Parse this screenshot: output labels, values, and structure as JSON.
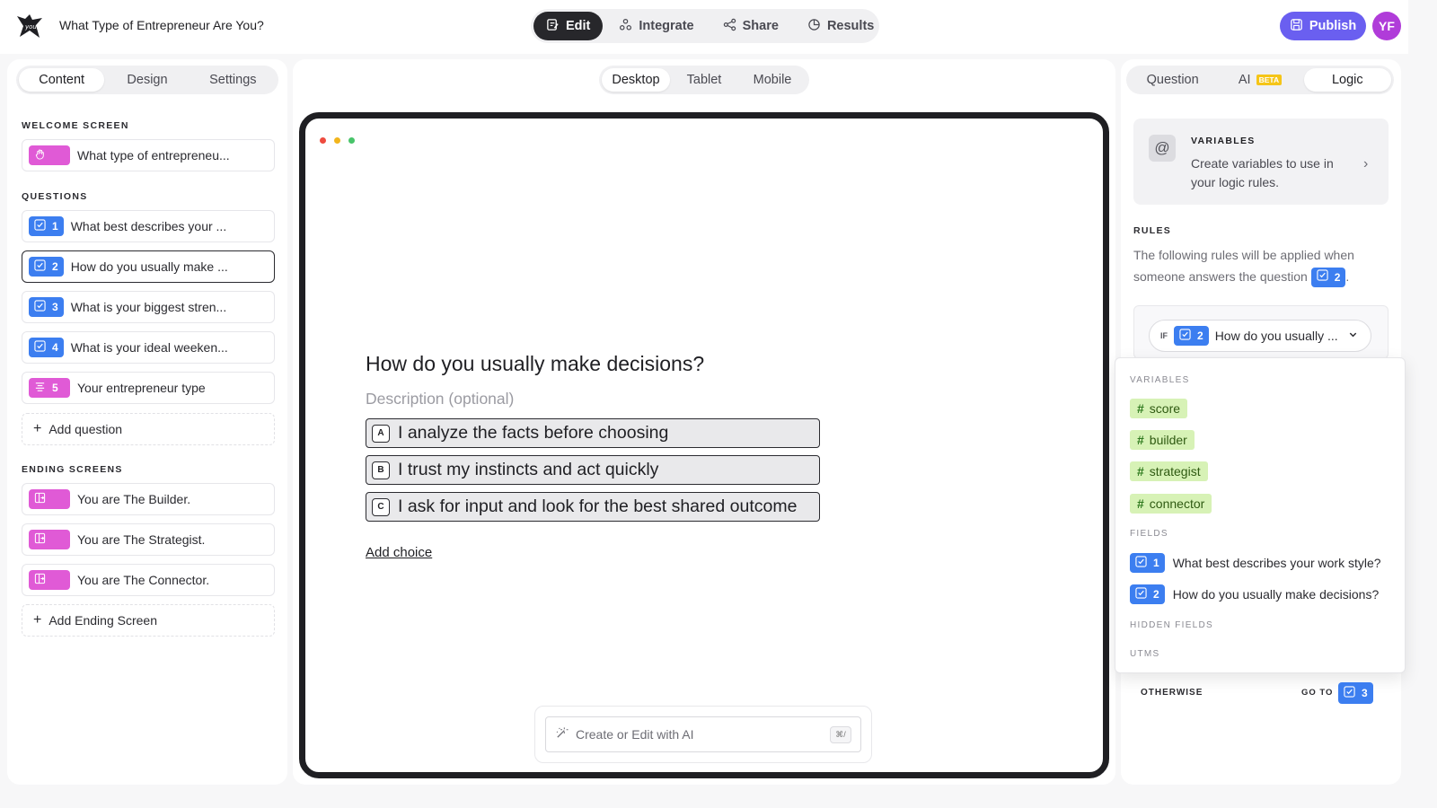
{
  "header": {
    "form_title": "What Type of Entrepreneur Are You?",
    "tabs": [
      {
        "label": "Edit",
        "icon": "edit-icon"
      },
      {
        "label": "Integrate",
        "icon": "integrate-icon"
      },
      {
        "label": "Share",
        "icon": "share-icon"
      },
      {
        "label": "Results",
        "icon": "results-icon"
      }
    ],
    "publish_label": "Publish",
    "avatar_initials": "YF"
  },
  "left": {
    "tabs": [
      "Content",
      "Design",
      "Settings"
    ],
    "welcome_label": "WELCOME SCREEN",
    "welcome_item": "What type of entrepreneu...",
    "questions_label": "QUESTIONS",
    "questions": [
      {
        "num": "1",
        "text": "What best describes your ..."
      },
      {
        "num": "2",
        "text": "How do you usually make ..."
      },
      {
        "num": "3",
        "text": "What is your biggest stren..."
      },
      {
        "num": "4",
        "text": "What is your ideal weeken..."
      },
      {
        "num": "5",
        "text": "Your entrepreneur type"
      }
    ],
    "add_question": "Add question",
    "ending_label": "ENDING SCREENS",
    "endings": [
      "You are The Builder.",
      "You are The Strategist.",
      "You are The Connector."
    ],
    "add_ending": "Add Ending Screen"
  },
  "center": {
    "device_tabs": [
      "Desktop",
      "Tablet",
      "Mobile"
    ],
    "question": "How do you usually make decisions?",
    "description_placeholder": "Description (optional)",
    "choices": [
      {
        "key": "A",
        "text": "I analyze the facts before choosing"
      },
      {
        "key": "B",
        "text": "I trust my instincts and act quickly"
      },
      {
        "key": "C",
        "text": "I ask for input and look for the best shared outcome"
      }
    ],
    "add_choice": "Add choice",
    "ai_placeholder": "Create or Edit with AI",
    "ai_shortcut": "⌘/"
  },
  "right": {
    "tabs": [
      "Question",
      "AI",
      "Logic"
    ],
    "ai_badge": "BETA",
    "variables_title": "VARIABLES",
    "variables_desc": "Create variables to use in your logic rules.",
    "rules_label": "RULES",
    "rules_text": "The following rules will be applied when someone answers the question",
    "rules_question_num": "2",
    "if_label": "IF",
    "if_num": "2",
    "if_text": "How do you usually ...",
    "dropdown": {
      "variables_label": "VARIABLES",
      "variables": [
        "score",
        "builder",
        "strategist",
        "connector"
      ],
      "fields_label": "FIELDS",
      "fields": [
        {
          "num": "1",
          "text": "What best describes your work style?"
        },
        {
          "num": "2",
          "text": "How do you usually make decisions?"
        }
      ],
      "hidden_label": "HIDDEN FIELDS",
      "utms_label": "UTMS"
    },
    "otherwise_label": "OTHERWISE",
    "goto_label": "GO TO",
    "goto_num": "3"
  },
  "colors": {
    "accent": "#6a5ff0",
    "question_badge": "#3c7ef0",
    "screen_badge": "#e05ad6",
    "variable_tag": "#d7f2b6"
  }
}
